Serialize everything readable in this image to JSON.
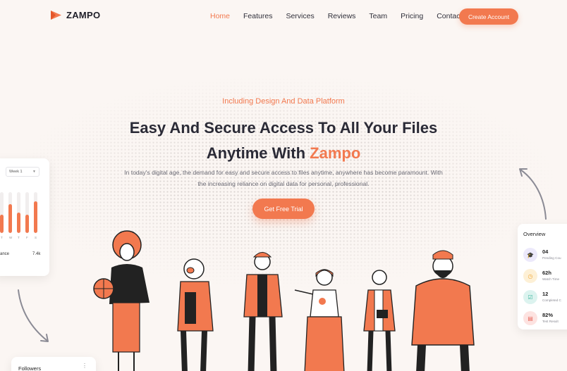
{
  "brand": {
    "name": "ZAMPO",
    "accent": "#f2794f"
  },
  "nav": {
    "items": [
      {
        "label": "Home",
        "active": true
      },
      {
        "label": "Features",
        "active": false
      },
      {
        "label": "Services",
        "active": false
      },
      {
        "label": "Reviews",
        "active": false
      },
      {
        "label": "Team",
        "active": false
      },
      {
        "label": "Pricing",
        "active": false
      },
      {
        "label": "Contact",
        "active": false
      }
    ],
    "cta_label": "Create Account"
  },
  "hero": {
    "eyebrow": "Including Design And Data Platform",
    "title_line1": "Easy And Secure Access To All Your Files",
    "title_line2_prefix": "Anytime With ",
    "title_line2_accent": "Zampo",
    "description": "In today's digital age, the demand for easy and secure access to files anytime, anywhere has become paramount. With the increasing reliance on digital data for personal, professional.",
    "cta_label": "Get Free Trial"
  },
  "left_card": {
    "select_value": "Week 1",
    "bars": [
      {
        "label": "T",
        "value": 0.45
      },
      {
        "label": "W",
        "value": 0.7
      },
      {
        "label": "T",
        "value": 0.5
      },
      {
        "label": "F",
        "value": 0.45
      },
      {
        "label": "S",
        "value": 0.78
      }
    ],
    "stat_label": "ance",
    "stat_value": "7.4k"
  },
  "overview_card": {
    "title": "Overview",
    "items": [
      {
        "value": "04",
        "label": "Pending Cou",
        "icon": "graduation-cap-icon",
        "bg": "#ece9fb",
        "color": "#7b6be6"
      },
      {
        "value": "62h",
        "label": "Watch Time",
        "icon": "clock-icon",
        "bg": "#fdf0d6",
        "color": "#f0a93a"
      },
      {
        "value": "12",
        "label": "Completed C",
        "icon": "checklist-icon",
        "bg": "#dcf3ef",
        "color": "#3bb59c"
      },
      {
        "value": "82%",
        "label": "Test Result",
        "icon": "clipboard-icon",
        "bg": "#fde3e1",
        "color": "#e8685c"
      }
    ]
  },
  "followers_card": {
    "title": "Followers",
    "more": "⋮"
  }
}
